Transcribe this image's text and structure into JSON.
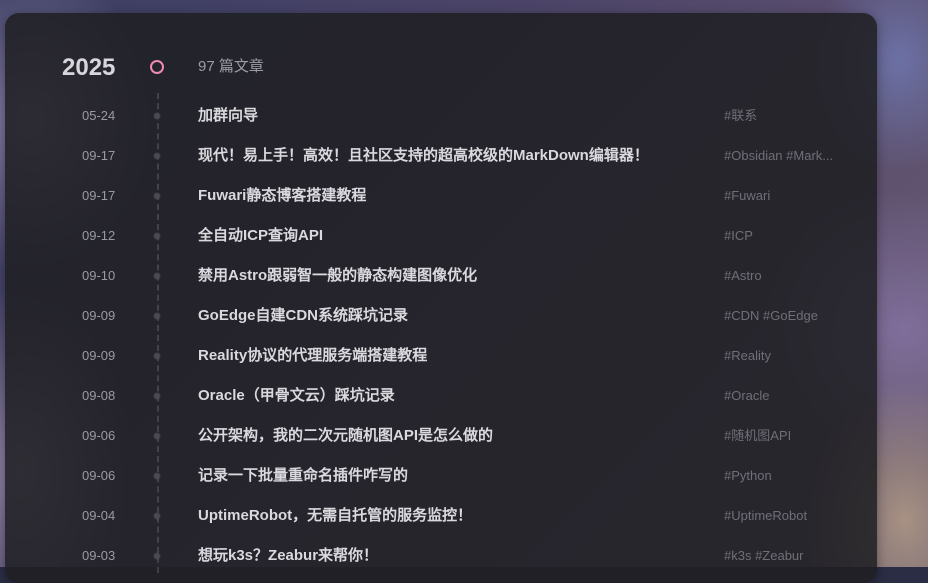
{
  "year": "2025",
  "post_count": "97 篇文章",
  "posts": [
    {
      "date": "05-24",
      "title": "加群向导",
      "tags": "#联系"
    },
    {
      "date": "09-17",
      "title": "现代！易上手！高效！且社区支持的超高校级的MarkDown编辑器！",
      "tags": "#Obsidian #Mark..."
    },
    {
      "date": "09-17",
      "title": "Fuwari静态博客搭建教程",
      "tags": "#Fuwari"
    },
    {
      "date": "09-12",
      "title": "全自动ICP查询API",
      "tags": "#ICP"
    },
    {
      "date": "09-10",
      "title": "禁用Astro跟弱智一般的静态构建图像优化",
      "tags": "#Astro"
    },
    {
      "date": "09-09",
      "title": "GoEdge自建CDN系统踩坑记录",
      "tags": "#CDN #GoEdge"
    },
    {
      "date": "09-09",
      "title": "Reality协议的代理服务端搭建教程",
      "tags": "#Reality"
    },
    {
      "date": "09-08",
      "title": "Oracle（甲骨文云）踩坑记录",
      "tags": "#Oracle"
    },
    {
      "date": "09-06",
      "title": "公开架构，我的二次元随机图API是怎么做的",
      "tags": "#随机图API"
    },
    {
      "date": "09-06",
      "title": "记录一下批量重命名插件咋写的",
      "tags": "#Python"
    },
    {
      "date": "09-04",
      "title": "UptimeRobot，无需自托管的服务监控！",
      "tags": "#UptimeRobot"
    },
    {
      "date": "09-03",
      "title": "想玩k3s？Zeabur来帮你！",
      "tags": "#k3s #Zeabur"
    }
  ],
  "colors": {
    "accent": "#f08ab4",
    "card_bg": "#1e1e22",
    "title_text": "#d9d9de",
    "muted_text": "#9a9aa2",
    "tag_text": "#6f6f78"
  }
}
